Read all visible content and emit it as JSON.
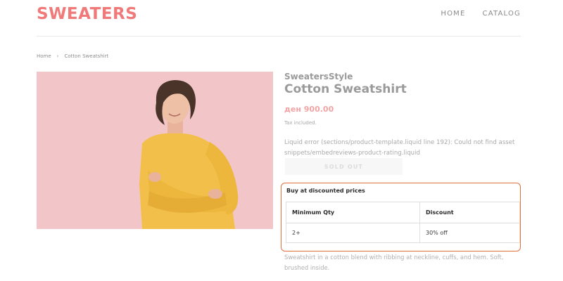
{
  "header": {
    "logo": "SWEATERS",
    "nav": [
      {
        "label": "HOME"
      },
      {
        "label": "CATALOG"
      }
    ]
  },
  "breadcrumb": {
    "home": "Home",
    "separator": "›",
    "current": "Cotton Sweatshirt"
  },
  "product": {
    "vendor": "SweatersStyle",
    "title": "Cotton Sweatshirt",
    "price": "ден 900.00",
    "tax_note": "Tax included.",
    "error_message": "Liquid error (sections/product-template.liquid line 192): Could not find asset snippets/embedreviews-product-rating.liquid",
    "sold_out_label": "SOLD OUT",
    "description": "Sweatshirt in a cotton blend with ribbing at neckline, cuffs, and hem. Soft, brushed inside."
  },
  "discounts": {
    "heading": "Buy at discounted prices",
    "columns": [
      "Minimum Qty",
      "Discount"
    ],
    "rows": [
      {
        "min_qty": "2+",
        "discount": "30% off"
      }
    ]
  },
  "colors": {
    "brand": "#f07a7a",
    "highlight_border": "#e2703b",
    "image_background": "#f2c5c9",
    "sweater": "#f2c04a"
  },
  "icons": {
    "product_photo": "woman-in-yellow-sweater-photo"
  }
}
